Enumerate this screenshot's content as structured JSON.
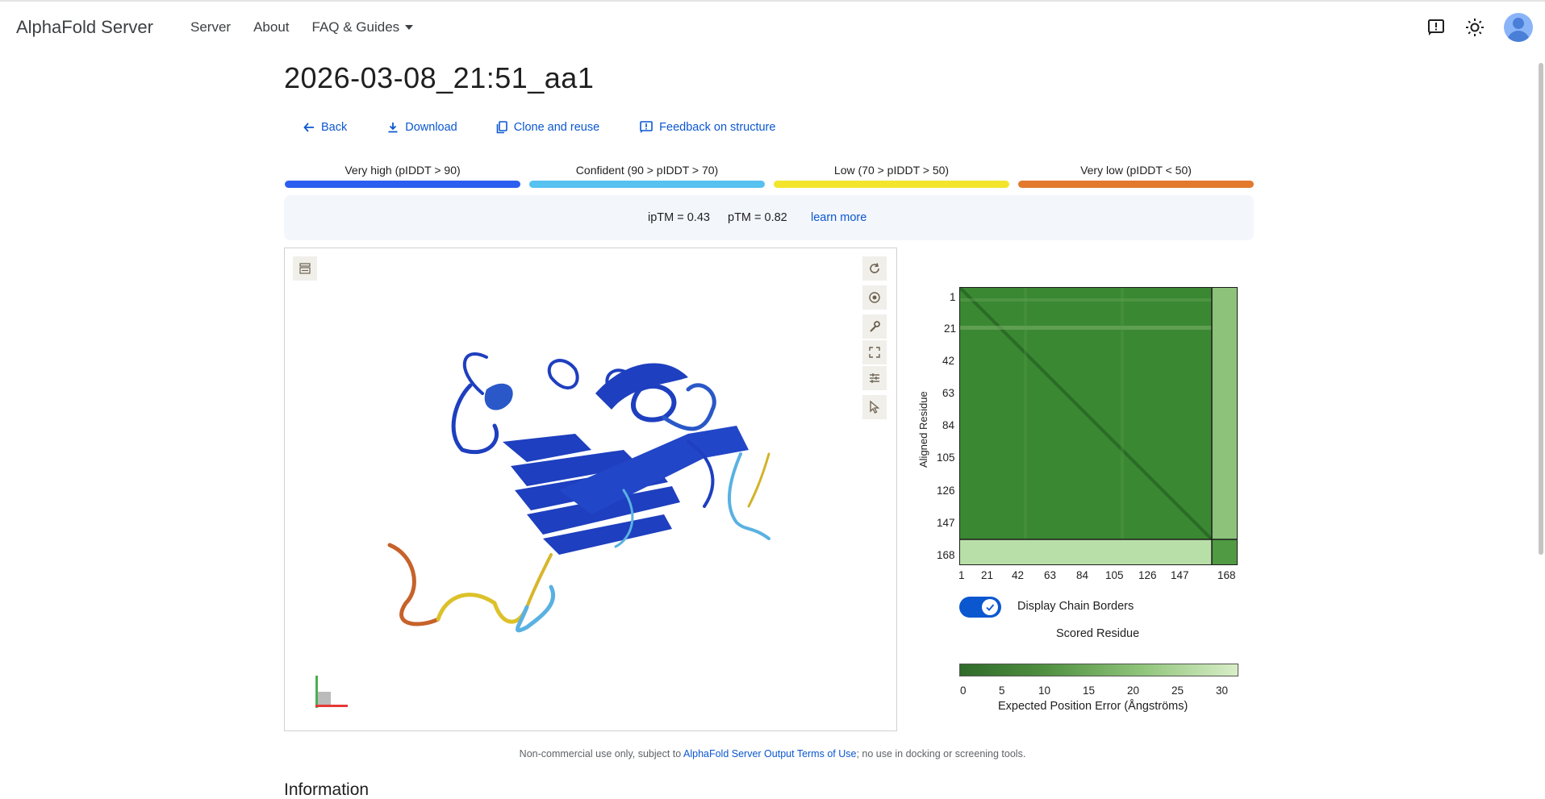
{
  "header": {
    "brand": "AlphaFold Server",
    "nav": [
      {
        "label": "Server"
      },
      {
        "label": "About"
      },
      {
        "label": "FAQ & Guides"
      }
    ],
    "icons": [
      "feedback-icon",
      "theme-brightness-icon",
      "account-avatar"
    ]
  },
  "page": {
    "title": "2026-03-08_21:51_aa1"
  },
  "actions": {
    "back": "Back",
    "download": "Download",
    "clone": "Clone and reuse",
    "feedback": "Feedback on structure"
  },
  "legend": [
    {
      "label": "Very high (pIDDT > 90)",
      "color": "#2c5ef0"
    },
    {
      "label": "Confident (90 > pIDDT > 70)",
      "color": "#57c1f0"
    },
    {
      "label": "Low (70 > pIDDT > 50)",
      "color": "#f2e52c"
    },
    {
      "label": "Very low (pIDDT < 50)",
      "color": "#e2792d"
    }
  ],
  "metrics": {
    "iptm": "ipTM = 0.43",
    "ptm": "pTM = 0.82",
    "learn_more": "learn more"
  },
  "viewer": {
    "tools": [
      "menu-icon",
      "rotate-icon",
      "camera-icon",
      "wrench-icon",
      "fullscreen-icon",
      "settings-icon",
      "select-icon"
    ]
  },
  "pae": {
    "y_axis_label": "Aligned Residue",
    "x_axis_label": "Scored Residue",
    "y_ticks": [
      "1",
      "21",
      "42",
      "63",
      "84",
      "105",
      "126",
      "147",
      "168"
    ],
    "x_ticks": [
      "1",
      "21",
      "42",
      "63",
      "84",
      "105",
      "126",
      "147",
      "168"
    ],
    "toggle_label": "Display Chain Borders",
    "toggle_on": true,
    "colorbar_ticks": [
      "0",
      "5",
      "10",
      "15",
      "20",
      "25",
      "30"
    ],
    "colorbar_label": "Expected Position Error (Ångströms)",
    "color_low": "#2f6a2a",
    "color_high": "#d9eec8"
  },
  "footer": {
    "prefix": "Non-commercial use only, subject to ",
    "link": "AlphaFold Server Output Terms of Use",
    "suffix": "; no use in docking or screening tools."
  },
  "section": {
    "info_title": "Information"
  }
}
